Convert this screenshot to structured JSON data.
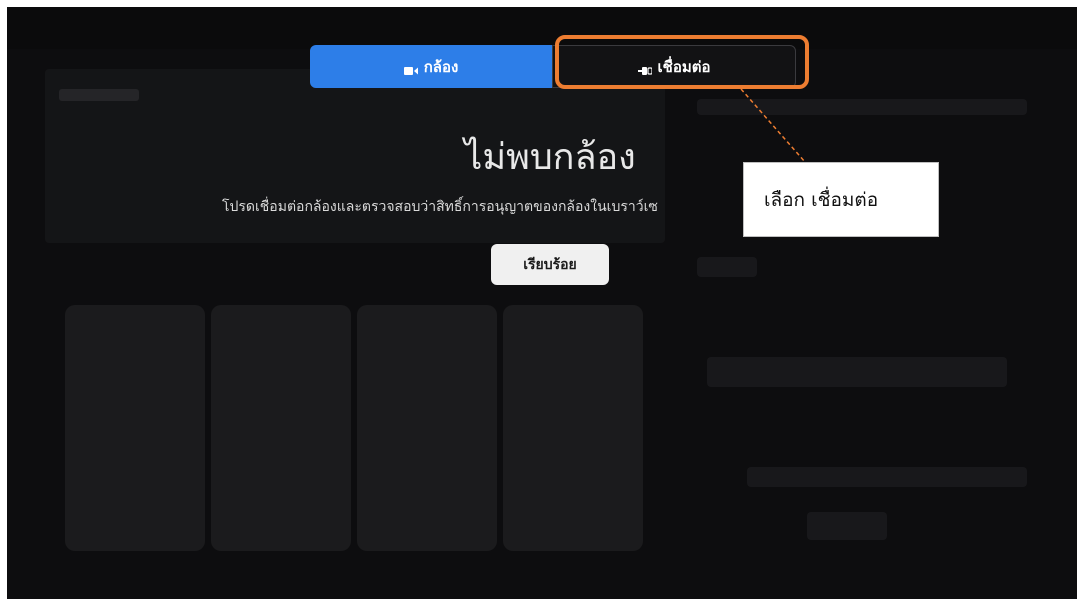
{
  "tabs": {
    "camera_label": "กล้อง",
    "connect_label": "เชื่อมต่อ",
    "active": "camera"
  },
  "dialog": {
    "title": "ไม่พบกล้อง",
    "description": "โปรดเชื่อมต่อกล้องและตรวจสอบว่าสิทธิ์การอนุญาตของกล้องในเบราว์เซ",
    "ok_button": "เรียบร้อย"
  },
  "annotation": {
    "callout_text": "เลือก เชื่อมต่อ",
    "highlight_color": "#ed7d31"
  },
  "colors": {
    "accent": "#2d7ee8",
    "backdrop": "#151517"
  },
  "icons": {
    "camera": "video-camera-icon",
    "connect": "plug-connect-icon"
  }
}
